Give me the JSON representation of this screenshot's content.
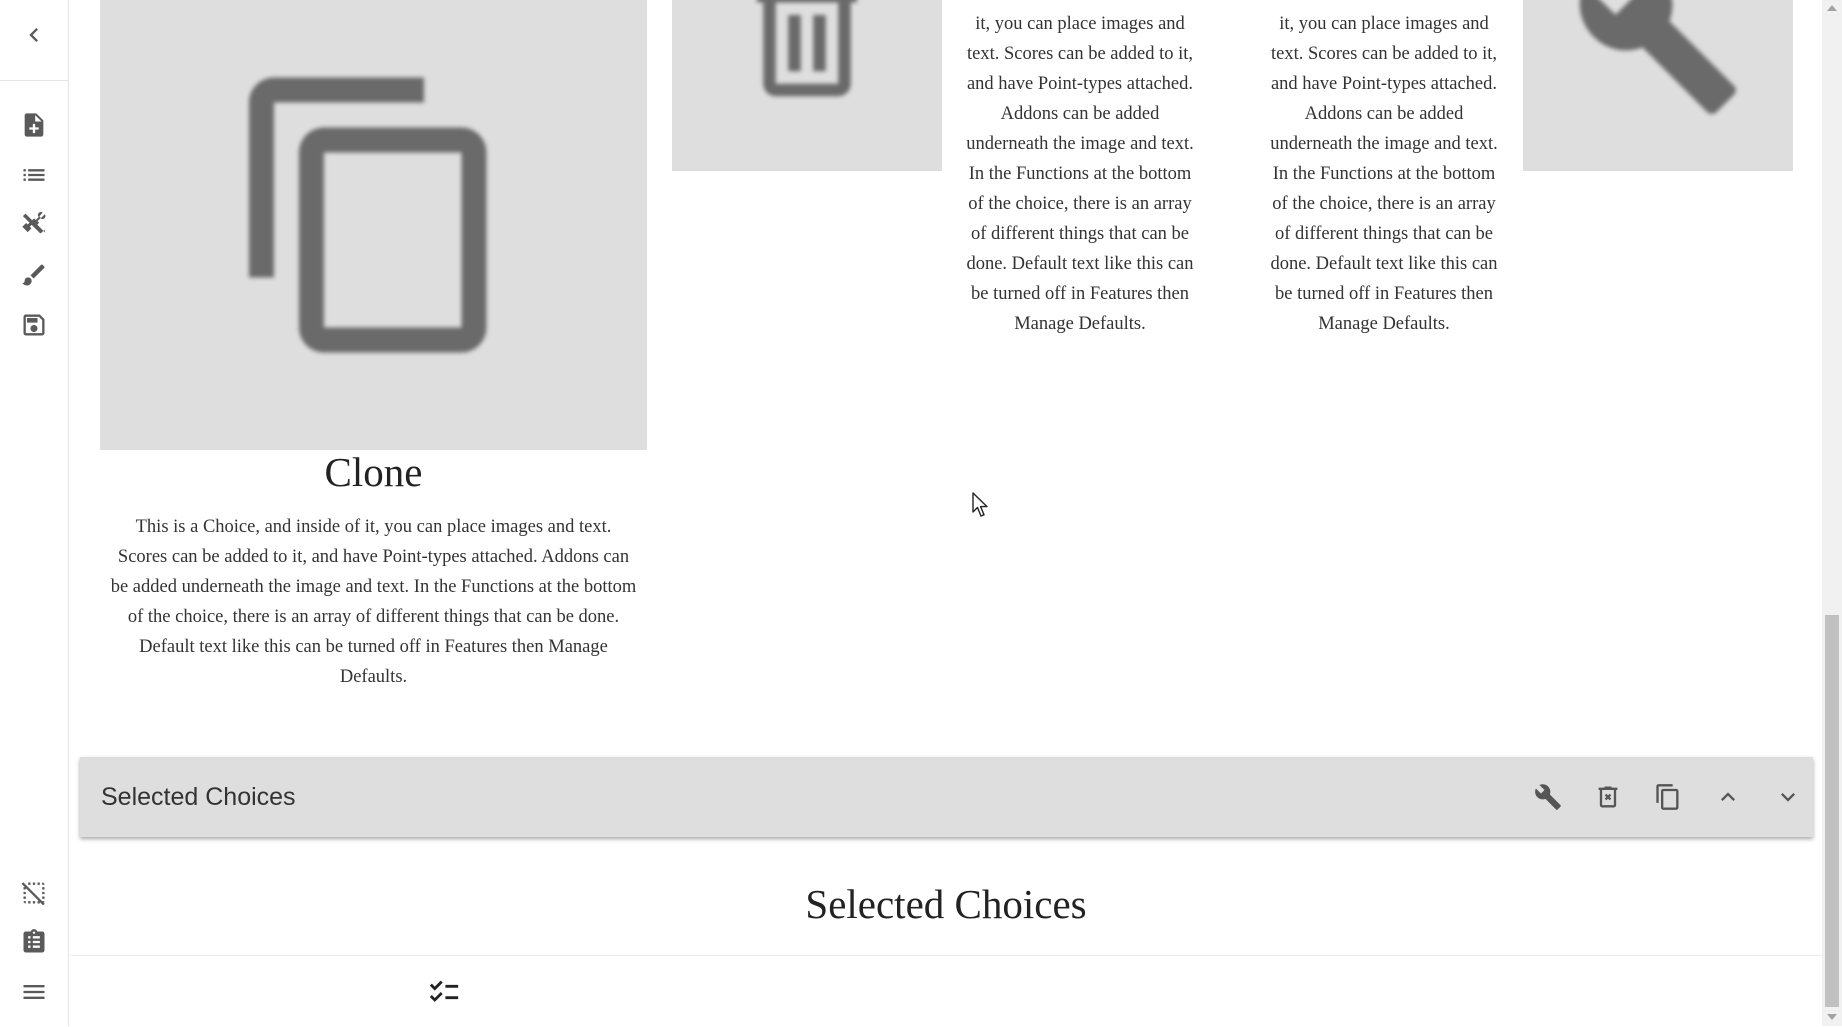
{
  "sidebar": {
    "top_items": [
      {
        "icon": "chevron-left-icon"
      },
      {
        "icon": "note-add-icon"
      },
      {
        "icon": "format-list-icon"
      },
      {
        "icon": "tools-icon"
      },
      {
        "icon": "brush-icon"
      },
      {
        "icon": "save-icon"
      }
    ],
    "bottom_items": [
      {
        "icon": "deselect-icon"
      },
      {
        "icon": "clipboard-list-icon"
      },
      {
        "icon": "menu-icon"
      }
    ]
  },
  "choices": [
    {
      "title": "Clone",
      "image_icon": "copy-icon",
      "text": "This is a Choice, and inside of it, you can place images and text. Scores can be added to it, and have Point-types attached. Addons can be added underneath the image and text. In the Functions at the bottom of the choice, there is an array of different things that can be done. Default text like this can be turned off in Features then Manage Defaults."
    },
    {
      "image_icon": "delete-icon"
    },
    {
      "text": "it, you can place images and text. Scores can be added to it, and have Point-types attached. Addons can be added underneath the image and text. In the Functions at the bottom of the choice, there is an array of different things that can be done. Default text like this can be turned off in Features then Manage Defaults."
    },
    {
      "text": "it, you can place images and text. Scores can be added to it, and have Point-types attached. Addons can be added underneath the image and text. In the Functions at the bottom of the choice, there is an array of different things that can be done. Default text like this can be turned off in Features then Manage Defaults."
    },
    {
      "image_icon": "wrench-icon"
    }
  ],
  "row_bar": {
    "title": "Selected Choices",
    "actions": [
      {
        "icon": "wrench-icon"
      },
      {
        "icon": "delete-icon"
      },
      {
        "icon": "copy-icon"
      },
      {
        "icon": "chevron-up-icon"
      },
      {
        "icon": "chevron-down-icon"
      }
    ]
  },
  "row_heading": "Selected Choices",
  "bottom_bar": {
    "icon": "checklist-icon"
  },
  "colors": {
    "image_bg": "#dedede",
    "bar_bg": "#dedede",
    "icon": "#5a5a5a"
  }
}
